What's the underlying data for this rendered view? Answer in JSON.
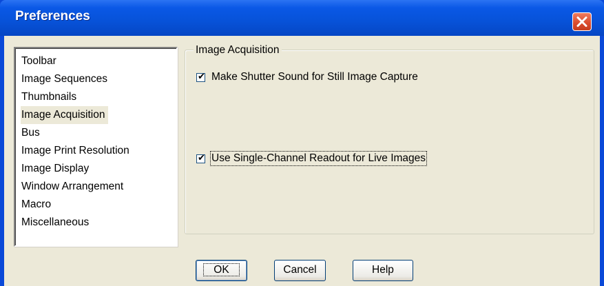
{
  "window": {
    "title": "Preferences",
    "close_icon": "close-icon",
    "colors": {
      "titlebar": "#0752d8",
      "client": "#ece9d8",
      "close_button": "#d94a2c"
    }
  },
  "categories": {
    "items": [
      {
        "label": "Toolbar"
      },
      {
        "label": "Image Sequences"
      },
      {
        "label": "Thumbnails"
      },
      {
        "label": "Image Acquisition"
      },
      {
        "label": "Bus"
      },
      {
        "label": "Image Print Resolution"
      },
      {
        "label": "Image Display"
      },
      {
        "label": "Window Arrangement"
      },
      {
        "label": "Macro"
      },
      {
        "label": "Miscellaneous"
      }
    ],
    "selected": "Image Acquisition"
  },
  "panel": {
    "title": "Image Acquisition",
    "options": [
      {
        "label": "Make Shutter Sound for Still Image Capture",
        "checked": true
      },
      {
        "label": "Use Single-Channel Readout for Live Images",
        "checked": true
      }
    ]
  },
  "buttons": {
    "ok": "OK",
    "cancel": "Cancel",
    "help": "Help"
  }
}
